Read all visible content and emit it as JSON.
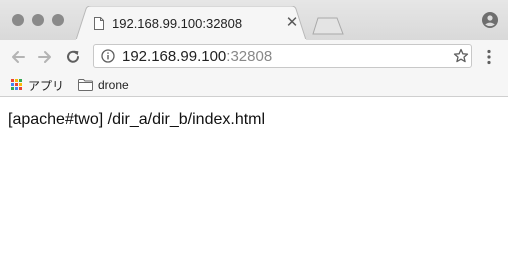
{
  "tab": {
    "title": "192.168.99.100:32808",
    "close_glyph": "✕"
  },
  "omnibox": {
    "host": "192.168.99.100",
    "port": ":32808"
  },
  "bookmarks": {
    "items": [
      {
        "label": "アプリ",
        "icon": "apps-grid-icon"
      },
      {
        "label": "drone",
        "icon": "folder-icon"
      }
    ]
  },
  "page": {
    "text": "[apache#two] /dir_a/dir_b/index.html"
  },
  "colors": {
    "tabstrip": "#dddddd",
    "toolbar": "#f6f6f6",
    "apps_grid": [
      "#e94335",
      "#fbbc05",
      "#34a853",
      "#4285f4",
      "#e94335",
      "#fbbc05",
      "#34a853",
      "#4285f4",
      "#e94335"
    ]
  }
}
